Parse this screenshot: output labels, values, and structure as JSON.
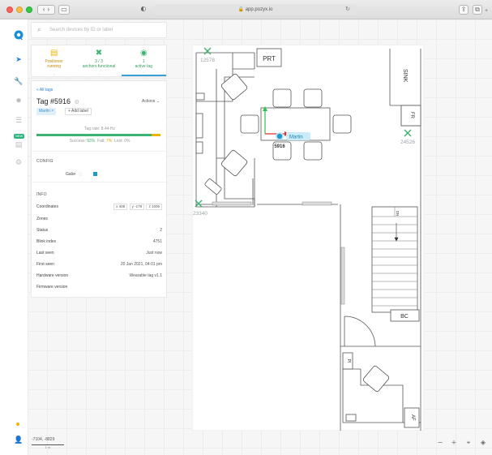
{
  "browser": {
    "url": "app.pozyx.io",
    "lock_icon": "lock-icon"
  },
  "rail": {
    "items": [
      "logo-icon",
      "navigate-icon",
      "wrench-icon",
      "gear-icon",
      "settings-sliders-icon",
      "layers-icon",
      "circle-gear-icon",
      "user-icon"
    ],
    "new_badge": "NEW"
  },
  "search": {
    "placeholder": "Search devices by ID or label"
  },
  "status_cards": [
    {
      "icon": "positioner-icon",
      "line1": "Positioner",
      "line2": "running",
      "color": "#f0b400"
    },
    {
      "icon": "anchor-icon",
      "line1": "3 / 3",
      "line2": "anchors functional",
      "color": "#3cb371"
    },
    {
      "icon": "tag-icon",
      "line1": "1",
      "line2": "active tag",
      "color": "#3cb371"
    }
  ],
  "detail": {
    "back_link": "« All tags",
    "title": "Tag #5916",
    "actions_label": "Actions",
    "label_chip": "Martin ×",
    "add_label": "+ Add label",
    "tag_rate": "Tag rate: 8.44 Hz",
    "success_label": "Success: ",
    "success_value": "93%",
    "fail_label": "Fail: ",
    "fail_value": "7%",
    "lost_label": "Lost: 0%",
    "success_fraction": 0.93,
    "fail_fraction": 0.07,
    "config_heading": "CONFIG",
    "galor_label": "Galor",
    "info_heading": "INFO",
    "coordinates_label": "Coordinates",
    "coord_x": "x 408",
    "coord_y": "y -179",
    "coord_z": "z 1006",
    "rows": [
      {
        "key": "Zones",
        "value": ""
      },
      {
        "key": "Status",
        "value": "2"
      },
      {
        "key": "Blink index",
        "value": "4751"
      },
      {
        "key": "Last seen",
        "value": "Just now"
      },
      {
        "key": "First seen",
        "value": "20 Jan 2021, 04:01 pm"
      },
      {
        "key": "Hardware version",
        "value": "Wearable tag v1.1"
      },
      {
        "key": "Firmware version",
        "value": ""
      }
    ]
  },
  "map": {
    "rooms": {
      "prt": "PRT",
      "sink": "SINK",
      "fr": "FR",
      "bc": "BC",
      "pi": "PI",
      "af": "AF",
      "dn": "DN"
    },
    "anchors": [
      {
        "id": "12578"
      },
      {
        "id": "24526"
      },
      {
        "id": "23340"
      }
    ],
    "tag_id": "5916",
    "tag_label": "Martin",
    "tag_color": "#1a9bc8",
    "scale_coords": "-7104, -8829",
    "scale_unit": "1 m"
  },
  "colors": {
    "accent": "#1a8fd8",
    "success": "#3cb371",
    "warning": "#f0b400"
  }
}
